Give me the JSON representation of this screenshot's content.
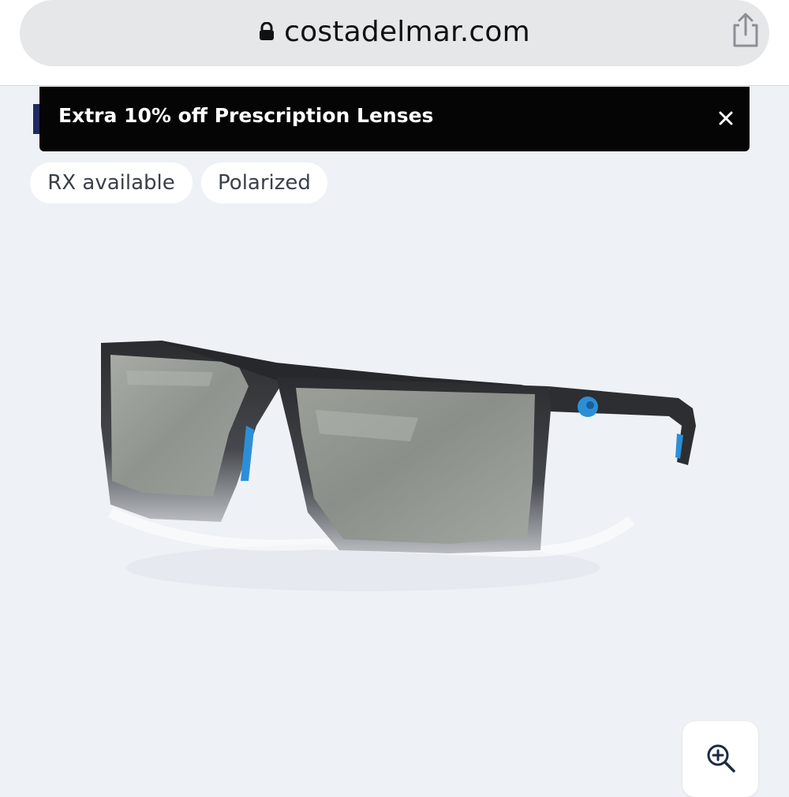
{
  "browser": {
    "url": "costadelmar.com",
    "icons": {
      "lock": "lock-icon",
      "share": "share-icon"
    }
  },
  "promo_banner": {
    "text": "Extra 10% off Prescription Lenses",
    "close_icon": "close-icon"
  },
  "chips": [
    {
      "label": "RX available"
    },
    {
      "label": "Polarized"
    }
  ],
  "product": {
    "image": "sunglasses-image",
    "zoom_icon": "zoom-in-icon"
  },
  "colors": {
    "page_background": "#eef1f5",
    "banner_background": "#050505",
    "accent_blue": "#2b8fd8"
  }
}
